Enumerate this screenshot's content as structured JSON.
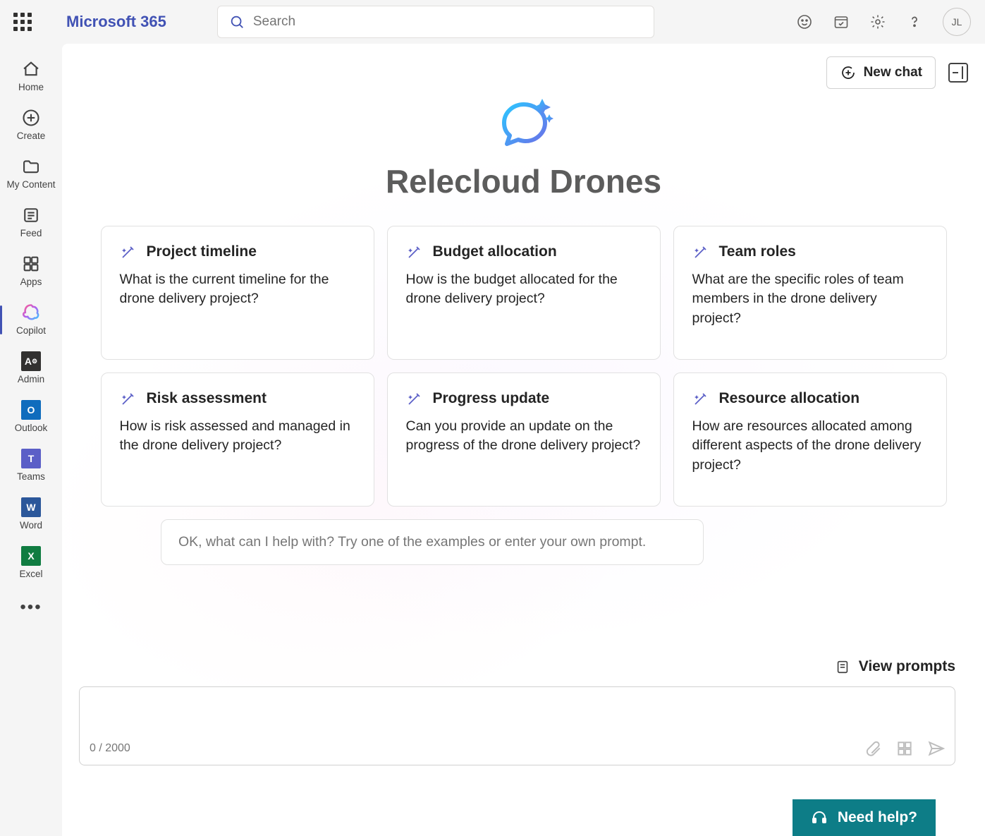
{
  "header": {
    "brand": "Microsoft 365",
    "search_placeholder": "Search",
    "avatar_initials": "JL"
  },
  "rail": {
    "items": [
      {
        "label": "Home"
      },
      {
        "label": "Create"
      },
      {
        "label": "My Content"
      },
      {
        "label": "Feed"
      },
      {
        "label": "Apps"
      },
      {
        "label": "Copilot"
      },
      {
        "label": "Admin"
      },
      {
        "label": "Outlook"
      },
      {
        "label": "Teams"
      },
      {
        "label": "Word"
      },
      {
        "label": "Excel"
      }
    ]
  },
  "main": {
    "new_chat_label": "New chat",
    "title": "Relecloud Drones",
    "cards": [
      {
        "title": "Project timeline",
        "body": "What is the current timeline for the drone delivery project?"
      },
      {
        "title": "Budget allocation",
        "body": "How is the budget allocated for the drone delivery project?"
      },
      {
        "title": "Team roles",
        "body": "What are the specific roles of team members in the drone delivery project?"
      },
      {
        "title": "Risk assessment",
        "body": "How is risk assessed and managed in the drone delivery project?"
      },
      {
        "title": "Progress update",
        "body": "Can you provide an update on the progress of the drone delivery project?"
      },
      {
        "title": "Resource allocation",
        "body": "How are resources allocated among different aspects of the drone delivery project?"
      }
    ],
    "example_hint": "OK, what can I help with? Try one of the examples or enter your own prompt.",
    "view_prompts_label": "View prompts",
    "char_counter": "0 / 2000",
    "need_help_label": "Need help?"
  }
}
